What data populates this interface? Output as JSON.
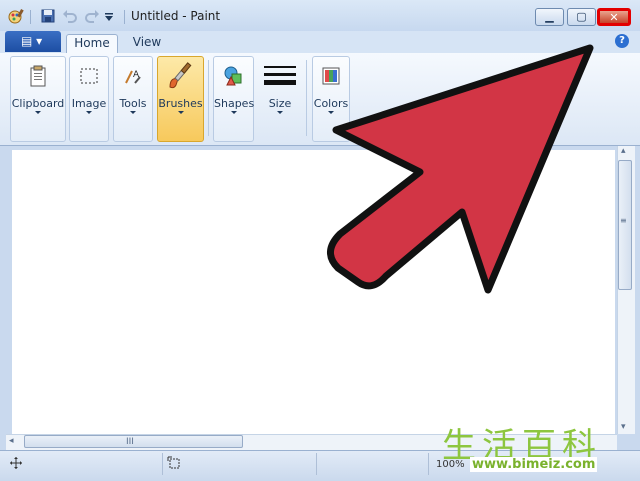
{
  "window": {
    "title": "Untitled - Paint",
    "minimize_glyph": "▁",
    "restore_glyph": "▢",
    "close_glyph": "✕"
  },
  "quick_access": {
    "icons": [
      "paint-app-icon",
      "save-icon",
      "undo-icon",
      "redo-icon",
      "customize-dropdown-icon"
    ]
  },
  "menu": {
    "file_glyph": "▤ ▾"
  },
  "tabs": [
    {
      "label": "Home",
      "active": true
    },
    {
      "label": "View",
      "active": false
    }
  ],
  "help_glyph": "?",
  "ribbon": {
    "groups": [
      {
        "label": "Clipboard",
        "icon": "clipboard-icon"
      },
      {
        "label": "Image",
        "icon": "select-icon"
      },
      {
        "label": "Tools",
        "icon": "tools-icon"
      },
      {
        "label": "Brushes",
        "icon": "brush-icon",
        "active": true
      },
      {
        "label": "Shapes",
        "icon": "shapes-icon"
      },
      {
        "label": "Size",
        "icon": "size-icon"
      },
      {
        "label": "Colors",
        "icon": "colors-icon"
      }
    ]
  },
  "scroll": {
    "grip_glyph": "III",
    "left_arrow": "◂",
    "right_arrow": "▸",
    "up_arrow": "▴",
    "down_arrow": "▾"
  },
  "status": {
    "zoom": "100%"
  },
  "watermark": {
    "chinese": "生活百科",
    "url": "www.bimeiz.com"
  },
  "colors": {
    "accent_arrow": "#d23545",
    "close_highlight": "#e30000"
  }
}
